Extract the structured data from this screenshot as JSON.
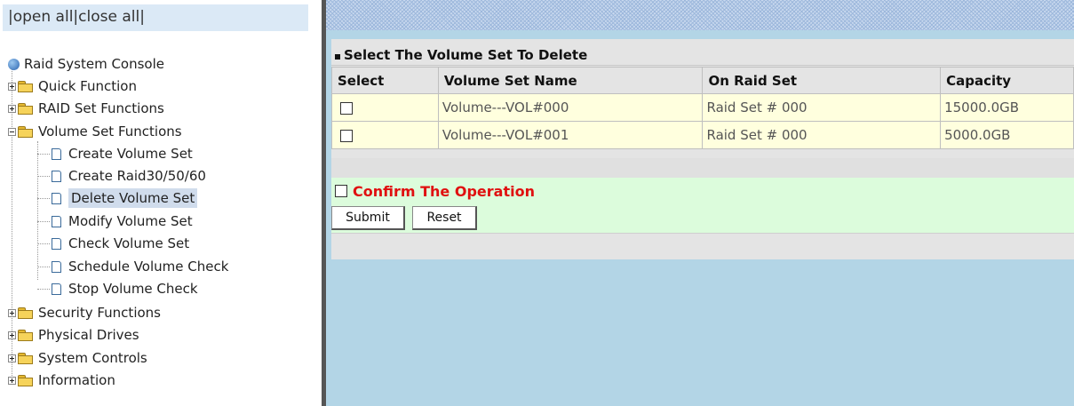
{
  "left_pane": {
    "open_all": "|open all",
    "close_all": "|close all|"
  },
  "tree": {
    "root": "Raid System Console",
    "items": [
      {
        "label": "Quick Function"
      },
      {
        "label": "RAID Set Functions"
      },
      {
        "label": "Volume Set Functions"
      },
      {
        "label": "Create Volume Set"
      },
      {
        "label": "Create Raid30/50/60"
      },
      {
        "label": "Delete Volume Set"
      },
      {
        "label": "Modify Volume Set"
      },
      {
        "label": "Check Volume Set"
      },
      {
        "label": "Schedule Volume Check"
      },
      {
        "label": "Stop Volume Check"
      },
      {
        "label": "Security Functions"
      },
      {
        "label": "Physical Drives"
      },
      {
        "label": "System Controls"
      },
      {
        "label": "Information"
      }
    ]
  },
  "panel": {
    "title": "Select The Volume Set To Delete",
    "columns": [
      "Select",
      "Volume Set Name",
      "On Raid Set",
      "Capacity"
    ],
    "rows": [
      {
        "name": "Volume---VOL#000",
        "raid_set": "Raid Set # 000",
        "capacity": "15000.0GB"
      },
      {
        "name": "Volume---VOL#001",
        "raid_set": "Raid Set # 000",
        "capacity": "5000.0GB"
      }
    ],
    "confirm_label": "Confirm The Operation",
    "submit_label": "Submit",
    "reset_label": "Reset"
  }
}
